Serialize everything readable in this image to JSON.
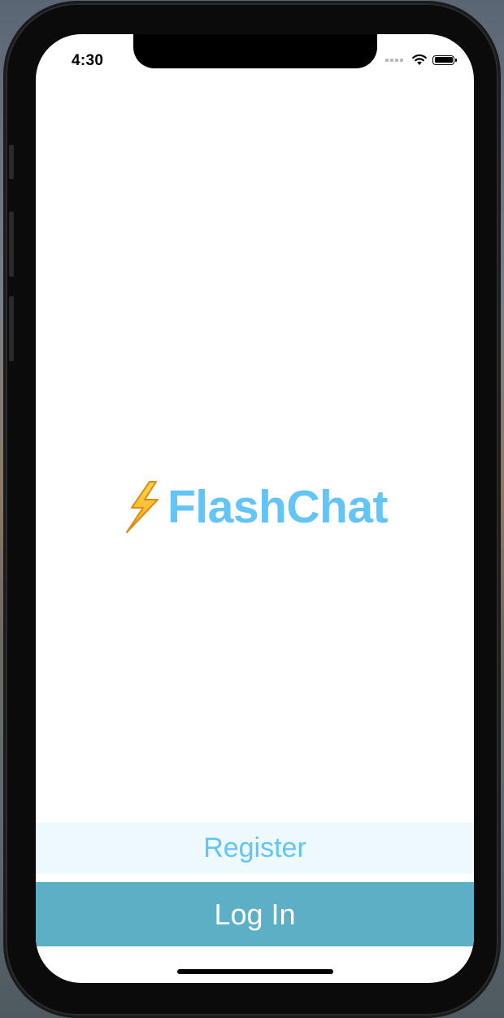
{
  "status_bar": {
    "time": "4:30",
    "icons": [
      "signal-dots-icon",
      "wifi-icon",
      "battery-icon"
    ]
  },
  "welcome": {
    "logo_icon": "lightning-bolt-icon",
    "title": "FlashChat"
  },
  "actions": {
    "register_label": "Register",
    "login_label": "Log In"
  },
  "colors": {
    "brand": "#63c4f6",
    "register_background": "#eef9fe",
    "login_background": "#5dafc5"
  }
}
